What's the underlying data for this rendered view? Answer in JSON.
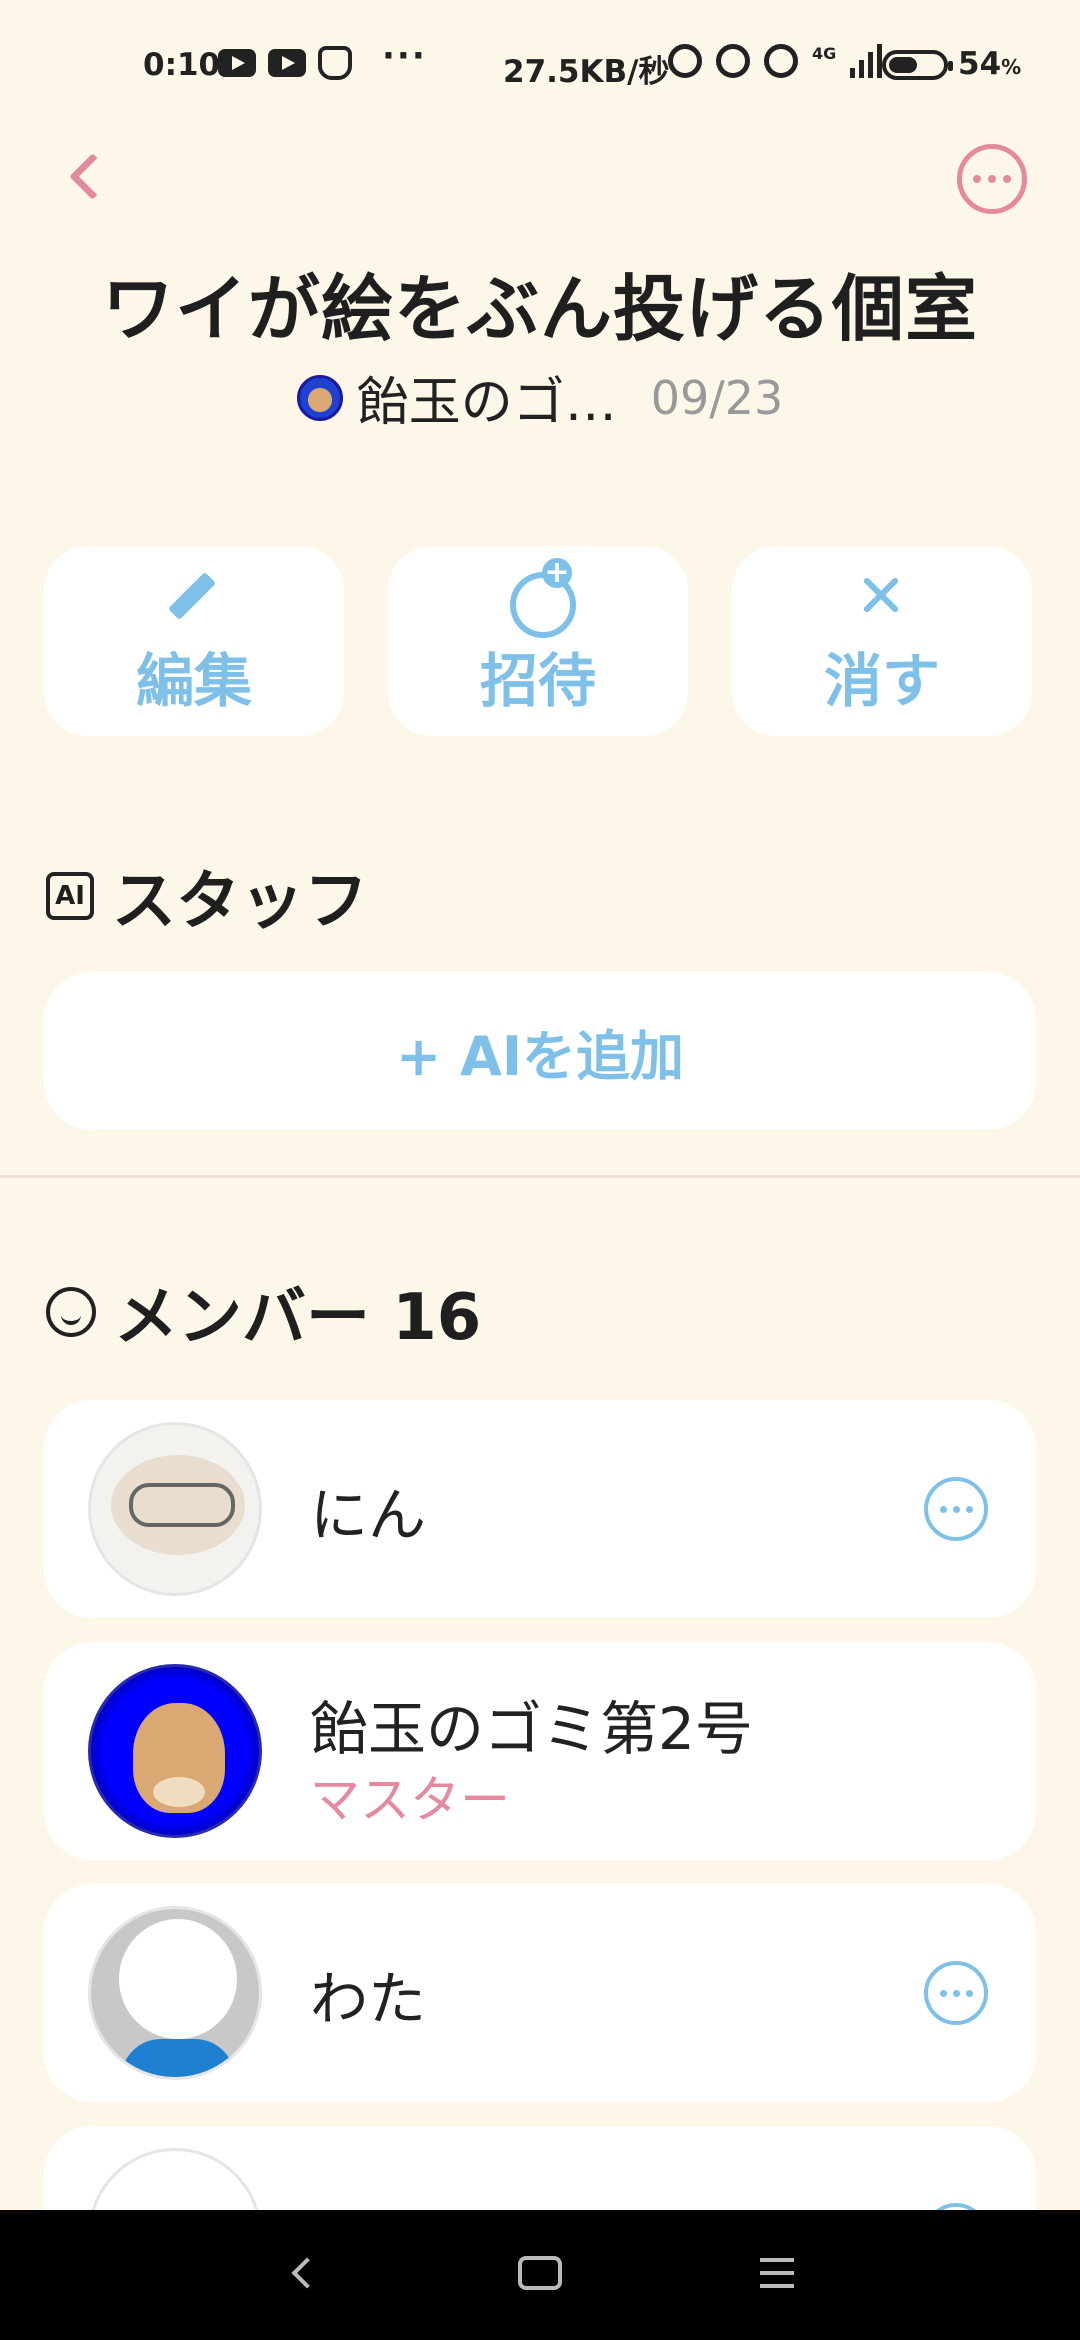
{
  "status_bar": {
    "time": "0:10",
    "more": "···",
    "net_speed": "27.5KB/秒",
    "network_type": "4G",
    "battery_value": "54",
    "battery_unit": "%",
    "battery_level": 0.54
  },
  "header": {
    "title": "ワイが絵をぶん投げる個室",
    "owner_name": "飴玉のゴ…",
    "date": "09/23"
  },
  "actions": [
    {
      "label": "編集",
      "icon": "pencil-icon"
    },
    {
      "label": "招待",
      "icon": "add-user-icon"
    },
    {
      "label": "消す",
      "icon": "close-icon"
    }
  ],
  "staff": {
    "title": "スタッフ",
    "badge": "AI",
    "add_label": "+ AIを追加"
  },
  "members": {
    "title": "メンバー 16",
    "items": [
      {
        "name": "にん",
        "role": ""
      },
      {
        "name": "飴玉のゴミ第2号",
        "role": "マスター"
      },
      {
        "name": "わた",
        "role": ""
      }
    ]
  },
  "colors": {
    "background": "#fdf7ea",
    "accent_pink": "#e58a9e",
    "accent_blue": "#7fc0e8"
  }
}
